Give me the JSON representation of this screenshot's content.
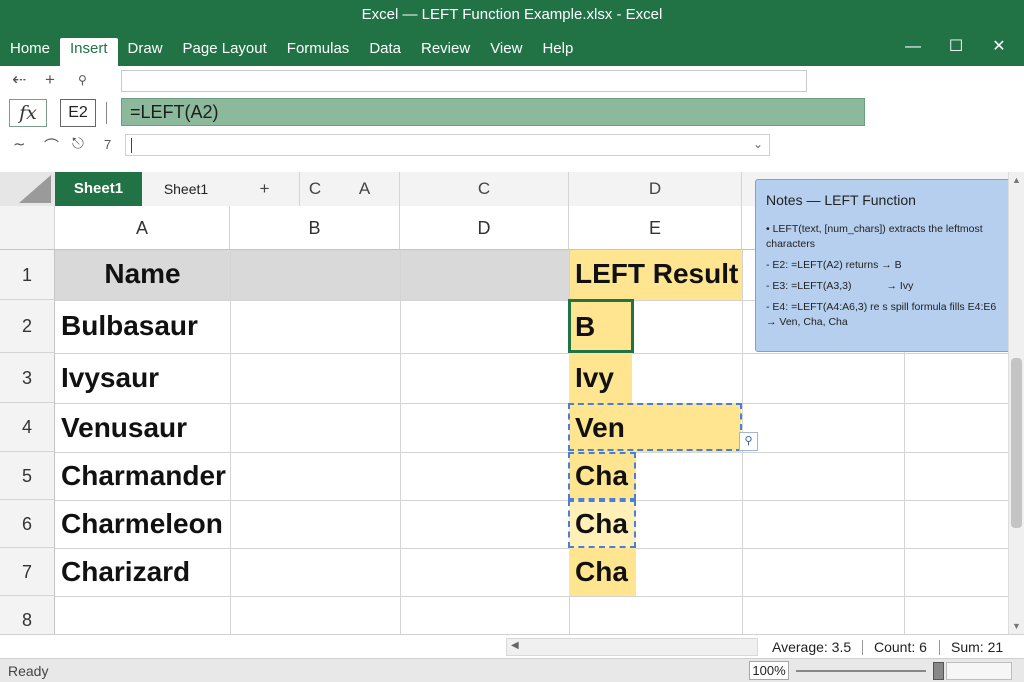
{
  "window": {
    "title": "Excel — LEFT Function Example.xlsx - Excel",
    "minimize_icon": "minimize-icon",
    "maximize_icon": "maximize-icon",
    "close_icon": "close-icon"
  },
  "ribbon": {
    "tabs": [
      {
        "label": "Home",
        "active": false
      },
      {
        "label": "Insert",
        "active": true
      },
      {
        "label": "Draw",
        "active": false
      },
      {
        "label": "Page Layout",
        "active": false
      },
      {
        "label": "Formulas",
        "active": false
      },
      {
        "label": "Data",
        "active": false
      },
      {
        "label": "Review",
        "active": false
      },
      {
        "label": "View",
        "active": false
      },
      {
        "label": "Help",
        "active": false
      }
    ]
  },
  "formula_bar": {
    "fx_label": "fx",
    "cell_ref": "E2",
    "formula": "=LEFT(A2)"
  },
  "subrow": {
    "number_label": "7"
  },
  "sheet_tabs": {
    "active": "Sheet1",
    "other": "Sheet1"
  },
  "top_headers": [
    "+",
    "C",
    "A",
    "C",
    "D"
  ],
  "columns": [
    "A",
    "B",
    "D",
    "E"
  ],
  "rows": [
    "1",
    "2",
    "3",
    "4",
    "5",
    "6",
    "7",
    "8"
  ],
  "cells": {
    "A1": "Name",
    "A2": "Bulbasaur",
    "A3": "Ivysaur",
    "A4": "Venusaur",
    "A5": "Charmander",
    "A6": "Charmeleon",
    "A7": "Charizard",
    "E1": "LEFT Result",
    "E2": "B",
    "E3": "Ivy",
    "E4": "Ven",
    "E5": "Cha",
    "E6": "Cha",
    "E7": "Cha"
  },
  "notes": {
    "title": "Notes — LEFT Function",
    "lines": [
      "• LEFT(text, [num_chars]) extracts the leftmost characters",
      "- E2: =LEFT(A2) returns → B",
      "- E3: =LEFT(A3,3)            → Ivy",
      "- E4: =LEFT(A4:A6,3) re s spill formula fills E4:E6 → Ven, Cha, Cha"
    ]
  },
  "summary": {
    "average": "Average: 3.5",
    "count": "Count: 6",
    "sum": "Sum: 21"
  },
  "status": {
    "ready": "Ready",
    "zoom": "100%",
    "zoom_level": 1.0
  },
  "colors": {
    "excel_green": "#217346",
    "formula_fill": "#8cb99b",
    "result_fill": "#ffe58f",
    "notes_fill": "#b6cfee"
  }
}
